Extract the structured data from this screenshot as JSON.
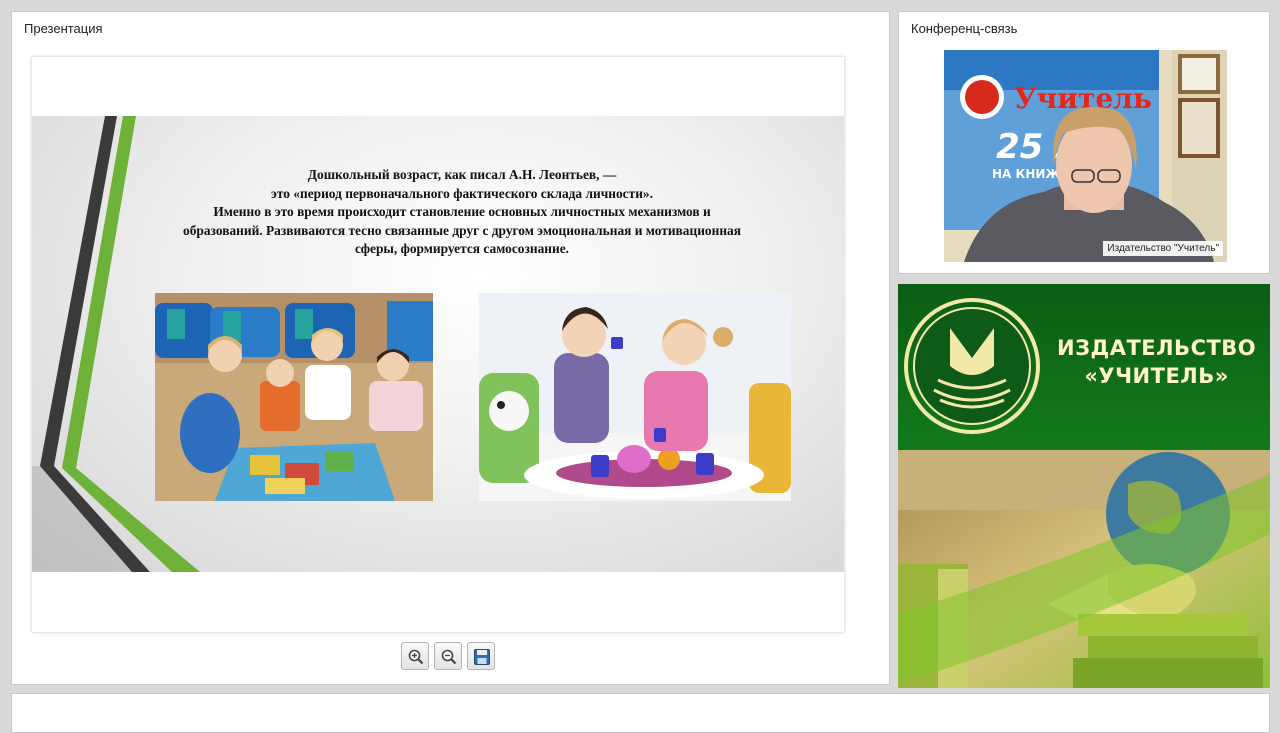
{
  "presentation": {
    "title": "Презентация",
    "slide": {
      "lines": [
        "Дошкольный возраст, как писал А.Н. Леонтьев, —",
        "это «период первоначального фактического склада личности».",
        "Именно в это время происходит становление основных личностных механизмов и",
        "образований. Развиваются тесно связанные друг с другом эмоциональная и мотивационная",
        "сферы, формируется самосознание."
      ]
    },
    "toolbar": {
      "zoom_in": "zoom-in-icon",
      "zoom_out": "zoom-out-icon",
      "save": "save-icon"
    }
  },
  "conference": {
    "title": "Конференц-связь",
    "participant": "Издательство \"Учитель\"",
    "backdrop_logo": "Учитель",
    "backdrop_years": "25 л",
    "backdrop_sub": "НА КНИЖН"
  },
  "publisher": {
    "line1": "ИЗДАТЕЛЬСТВО",
    "line2": "«УЧИТЕЛЬ»"
  },
  "colors": {
    "accent_green": "#6fb23a",
    "banner_green": "#0f5a16",
    "slide_dark": "#333333"
  }
}
